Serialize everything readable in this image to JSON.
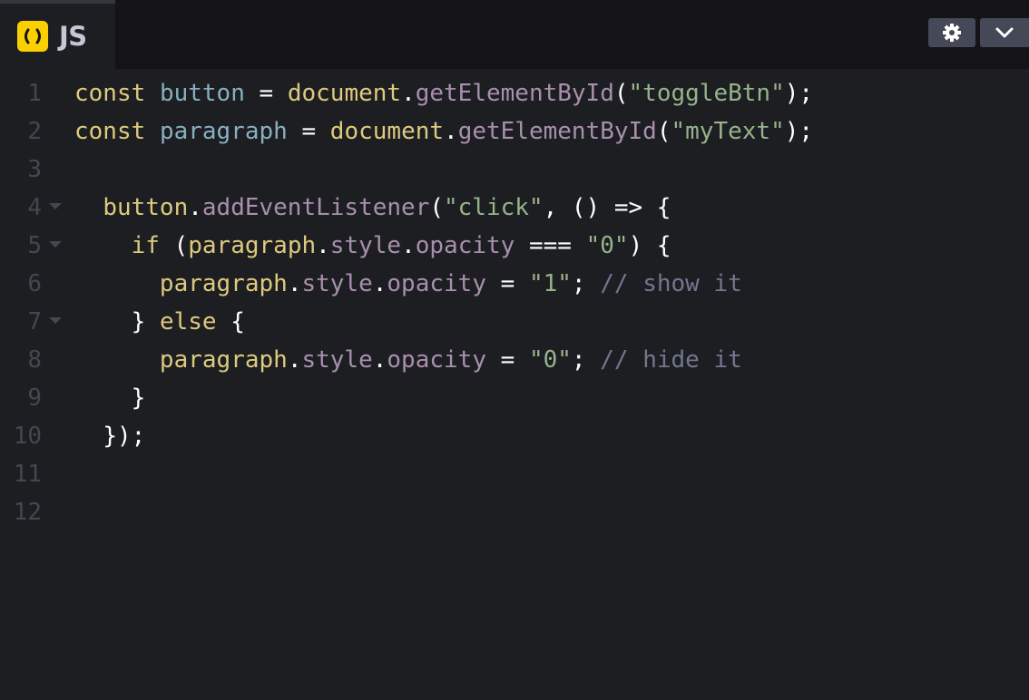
{
  "tab": {
    "label": "JS",
    "icon": "js-file-icon",
    "icon_color": "#fcd000"
  },
  "controls": {
    "settings_icon": "gear-icon",
    "collapse_icon": "chevron-down-icon"
  },
  "colors": {
    "background": "#1d1e22",
    "header": "#141416",
    "keyword": "#ddca7e",
    "variable": "#88afbf",
    "property": "#a88fae",
    "string": "#96b38a",
    "comment": "#717790",
    "line_number": "#45474e"
  },
  "line_numbers": [
    "1",
    "2",
    "3",
    "4",
    "5",
    "6",
    "7",
    "8",
    "9",
    "10",
    "11",
    "12"
  ],
  "code": {
    "l1": [
      {
        "t": "kw",
        "v": "const"
      },
      {
        "t": "pun",
        "v": " "
      },
      {
        "t": "var",
        "v": "button"
      },
      {
        "t": "pun",
        "v": " = "
      },
      {
        "t": "obj",
        "v": "document"
      },
      {
        "t": "pun",
        "v": "."
      },
      {
        "t": "prop",
        "v": "getElementById"
      },
      {
        "t": "pun",
        "v": "("
      },
      {
        "t": "str",
        "v": "\"toggleBtn\""
      },
      {
        "t": "pun",
        "v": ");"
      }
    ],
    "l2": [
      {
        "t": "kw",
        "v": "const"
      },
      {
        "t": "pun",
        "v": " "
      },
      {
        "t": "var",
        "v": "paragraph"
      },
      {
        "t": "pun",
        "v": " = "
      },
      {
        "t": "obj",
        "v": "document"
      },
      {
        "t": "pun",
        "v": "."
      },
      {
        "t": "prop",
        "v": "getElementById"
      },
      {
        "t": "pun",
        "v": "("
      },
      {
        "t": "str",
        "v": "\"myText\""
      },
      {
        "t": "pun",
        "v": ");"
      }
    ],
    "l4": [
      {
        "t": "obj",
        "v": "button"
      },
      {
        "t": "pun",
        "v": "."
      },
      {
        "t": "prop",
        "v": "addEventListener"
      },
      {
        "t": "pun",
        "v": "("
      },
      {
        "t": "str",
        "v": "\"click\""
      },
      {
        "t": "pun",
        "v": ", () => {"
      }
    ],
    "l5": [
      {
        "t": "kw",
        "v": "if"
      },
      {
        "t": "pun",
        "v": " ("
      },
      {
        "t": "obj",
        "v": "paragraph"
      },
      {
        "t": "pun",
        "v": "."
      },
      {
        "t": "prop",
        "v": "style"
      },
      {
        "t": "pun",
        "v": "."
      },
      {
        "t": "prop",
        "v": "opacity"
      },
      {
        "t": "pun",
        "v": " === "
      },
      {
        "t": "str",
        "v": "\"0\""
      },
      {
        "t": "pun",
        "v": ") {"
      }
    ],
    "l6": [
      {
        "t": "obj",
        "v": "paragraph"
      },
      {
        "t": "pun",
        "v": "."
      },
      {
        "t": "prop",
        "v": "style"
      },
      {
        "t": "pun",
        "v": "."
      },
      {
        "t": "prop",
        "v": "opacity"
      },
      {
        "t": "pun",
        "v": " = "
      },
      {
        "t": "str",
        "v": "\"1\""
      },
      {
        "t": "pun",
        "v": "; "
      },
      {
        "t": "cmt",
        "v": "// show it"
      }
    ],
    "l7": [
      {
        "t": "pun",
        "v": "} "
      },
      {
        "t": "kw",
        "v": "else"
      },
      {
        "t": "pun",
        "v": " {"
      }
    ],
    "l8": [
      {
        "t": "obj",
        "v": "paragraph"
      },
      {
        "t": "pun",
        "v": "."
      },
      {
        "t": "prop",
        "v": "style"
      },
      {
        "t": "pun",
        "v": "."
      },
      {
        "t": "prop",
        "v": "opacity"
      },
      {
        "t": "pun",
        "v": " = "
      },
      {
        "t": "str",
        "v": "\"0\""
      },
      {
        "t": "pun",
        "v": "; "
      },
      {
        "t": "cmt",
        "v": "// hide it"
      }
    ],
    "l9": [
      {
        "t": "pun",
        "v": "}"
      }
    ],
    "l10": [
      {
        "t": "pun",
        "v": "});"
      }
    ]
  }
}
